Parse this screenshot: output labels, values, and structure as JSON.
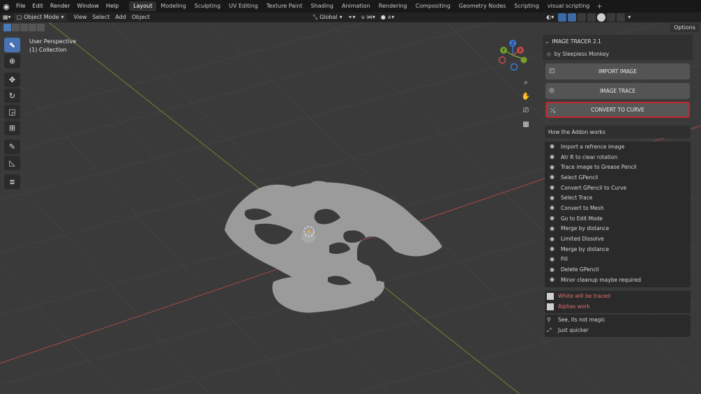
{
  "menubar": {
    "items": [
      "File",
      "Edit",
      "Render",
      "Window",
      "Help"
    ],
    "workspaces": [
      "Layout",
      "Modeling",
      "Sculpting",
      "UV Editing",
      "Texture Paint",
      "Shading",
      "Animation",
      "Rendering",
      "Compositing",
      "Geometry Nodes",
      "Scripting",
      "visual scripting"
    ],
    "active_workspace": "Layout",
    "add_symbol": "+"
  },
  "header": {
    "mode": "Object Mode",
    "menus": [
      "View",
      "Select",
      "Add",
      "Object"
    ],
    "orientation": "Global",
    "options_label": "Options"
  },
  "viewport": {
    "perspective": "User Perspective",
    "collection": "(1) Collection",
    "gizmo": {
      "x": "X",
      "y": "Y",
      "z": "Z"
    }
  },
  "panel": {
    "title": "IMAGE TRACER 2.1",
    "author": "by Sleepless Monkey",
    "buttons": {
      "import": "IMPORT IMAGE",
      "trace": "IMAGE TRACE",
      "convert": "CONVERT TO CURVE"
    },
    "how_title": "How the Addon works",
    "steps": [
      "Import a refrence image",
      "Atr R to clear rotation",
      "Trace image to Grease Pencil",
      "Select GPencil",
      "Convert GPencil to Curve",
      "Select Trace",
      "Convert to Mesh",
      "Go to Edit Mode",
      "Merge by distance",
      "Limited Dissolve",
      "Merge by distance",
      "Fill",
      "Delete GPencil",
      "Minor cleanup maybe required"
    ],
    "notes": [
      "White will be traced",
      "Alphas work"
    ],
    "extras": [
      "See, its not magic",
      "Just quicker"
    ]
  },
  "colors": {
    "accent": "#4772b3",
    "highlight_border": "#c2262e",
    "note_text": "#e07070",
    "x_axis": "#c44b4b",
    "y_axis": "#7aa02c",
    "mesh": "#9b9b9b"
  }
}
